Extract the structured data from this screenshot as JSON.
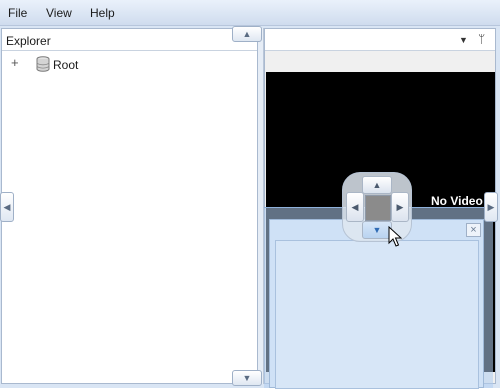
{
  "menubar": {
    "items": [
      "File",
      "View",
      "Help"
    ]
  },
  "explorer": {
    "title": "Explorer",
    "tree": [
      {
        "expander": "+",
        "icon": "database-icon",
        "label": "Root"
      }
    ]
  },
  "video": {
    "status_text": "No Video"
  },
  "float_window": {
    "close_glyph": "×"
  },
  "glyphs": {
    "up": "▲",
    "down": "▼",
    "left": "◀",
    "right": "▶",
    "dropdown": "▼",
    "pin": "ᛘ"
  },
  "colors": {
    "menubar_top": "#eaf1fb",
    "menubar_bottom": "#cfdcee",
    "dock_preview": "#b0cef0",
    "video_bg": "#000000"
  }
}
